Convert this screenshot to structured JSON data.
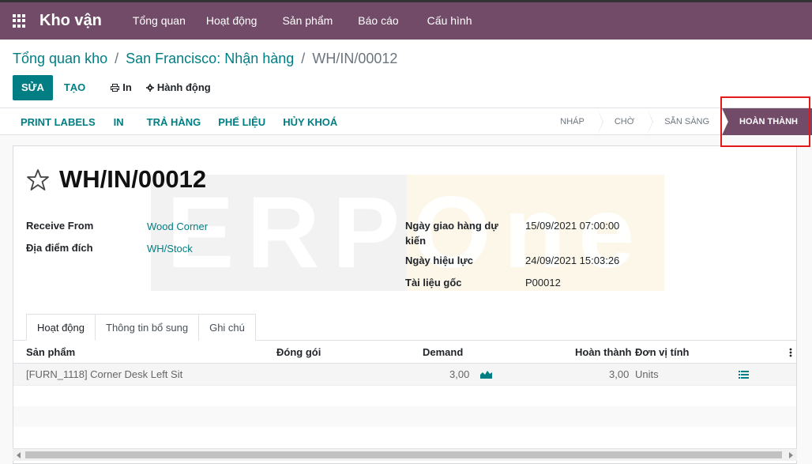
{
  "navbar": {
    "app_name": "Kho vận",
    "menu": [
      "Tổng quan",
      "Hoạt động",
      "Sản phẩm",
      "Báo cáo",
      "Cấu hình"
    ]
  },
  "breadcrumb": {
    "crumb1": "Tổng quan kho",
    "crumb2": "San Francisco: Nhận hàng",
    "current": "WH/IN/00012",
    "separator": "/"
  },
  "toolbar": {
    "edit_label": "SỬA",
    "create_label": "TẠO",
    "print_label": "In",
    "action_label": "Hành động"
  },
  "header_buttons": [
    "PRINT LABELS",
    "IN",
    "TRẢ HÀNG",
    "PHẾ LIỆU",
    "HỦY KHOÁ"
  ],
  "stages": [
    {
      "label": "NHÁP",
      "active": false
    },
    {
      "label": "CHỜ",
      "active": false
    },
    {
      "label": "SẴN SÀNG",
      "active": false
    },
    {
      "label": "HOÀN THÀNH",
      "active": true
    }
  ],
  "record": {
    "name": "WH/IN/00012",
    "watermark": "ERPOne"
  },
  "fields": {
    "receive_from_label": "Receive From",
    "receive_from_value": "Wood Corner",
    "destination_label": "Địa điểm đích",
    "destination_value": "WH/Stock",
    "scheduled_label_line1": "Ngày giao hàng dự",
    "scheduled_label_line2": "kiến",
    "scheduled_value": "15/09/2021 07:00:00",
    "effective_label": "Ngày hiệu lực",
    "effective_value": "24/09/2021 15:03:26",
    "origin_label": "Tài liệu gốc",
    "origin_value": "P00012"
  },
  "tabs": [
    "Hoạt động",
    "Thông tin bổ sung",
    "Ghi chú"
  ],
  "table": {
    "headers": {
      "product": "Sản phẩm",
      "package": "Đóng gói",
      "demand": "Demand",
      "done": "Hoàn thành",
      "uom": "Đơn vị tính"
    },
    "rows": [
      {
        "product": "[FURN_1118] Corner Desk Left Sit",
        "demand": "3,00",
        "done": "3,00",
        "uom": "Units"
      }
    ]
  },
  "colors": {
    "brand": "#714b67",
    "accent": "#017e84",
    "highlight": "#e31a1c"
  }
}
